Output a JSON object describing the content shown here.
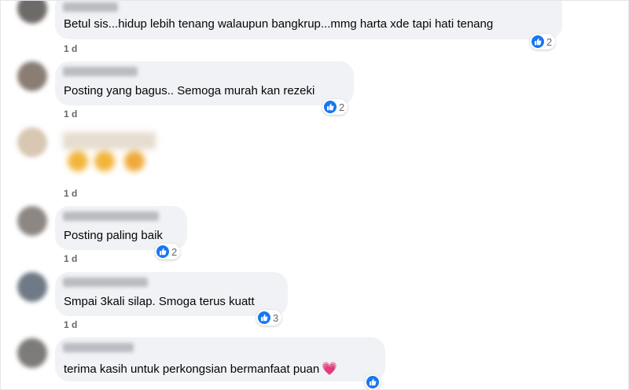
{
  "comments": [
    {
      "text": "Betul sis...hidup lebih tenang walaupun bangkrup...mmg harta xde tapi hati tenang",
      "reactions": "2",
      "time": "1 d"
    },
    {
      "text": "Posting yang bagus.. Semoga murah kan rezeki",
      "reactions": "2",
      "time": "1 d"
    },
    {
      "text": "",
      "reactions": "",
      "time": "1 d",
      "sticker": "emoji-sticker"
    },
    {
      "text": "Posting paling baik",
      "reactions": "2",
      "time": "1 d"
    },
    {
      "text": "Smpai 3kali silap. Smoga terus kuatt",
      "reactions": "3",
      "time": "1 d"
    },
    {
      "text": "terima kasih untuk perkongsian bermanfaat puan",
      "emoji": "💗",
      "reactions": "",
      "time": ""
    }
  ],
  "colors": {
    "bubble": "#f0f2f5",
    "like": "#1877f2",
    "meta_text": "#65676b",
    "heart": "#e87ac7"
  },
  "icons": {
    "reaction": "like-thumb-icon",
    "avatar": "blurred-avatar",
    "name": "blurred-name"
  }
}
